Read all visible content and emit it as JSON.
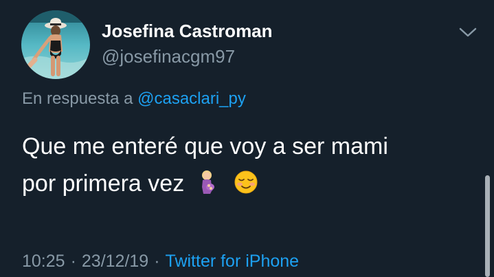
{
  "author": {
    "display_name": "Josefina Castroman",
    "handle": "@josefinacgm97",
    "avatar_icon": "profile-photo"
  },
  "reply": {
    "prefix": "En respuesta a",
    "mention": "@casaclari_py"
  },
  "tweet": {
    "line1": "Que me enteré que voy a ser mami",
    "line2": "por primera vez",
    "emojis": [
      "pregnant-woman-icon",
      "smiling-face-icon"
    ]
  },
  "meta": {
    "time": "10:25",
    "separator": "·",
    "date": "23/12/19",
    "source": "Twitter for iPhone"
  },
  "colors": {
    "background": "#15202b",
    "primary_text": "#ffffff",
    "secondary_text": "#8899a6",
    "accent": "#1da1f2"
  },
  "menu_icon": "chevron-down-icon"
}
